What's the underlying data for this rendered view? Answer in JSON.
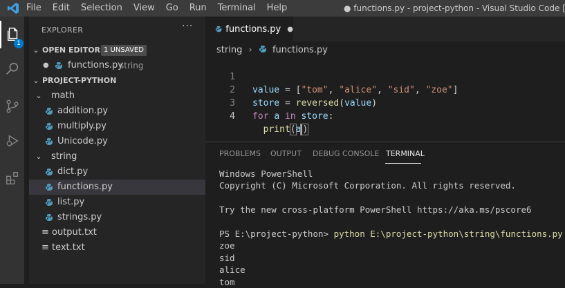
{
  "titlebar": {
    "menu": [
      "File",
      "Edit",
      "Selection",
      "View",
      "Go",
      "Run",
      "Terminal",
      "Help"
    ],
    "window_title": "● functions.py - project-python - Visual Studio Code [Unsup"
  },
  "activity": {
    "explorer_badge": "1"
  },
  "explorer": {
    "header": "EXPLORER",
    "more": "···",
    "open_editors": {
      "title": "OPEN EDITORS",
      "badge": "1 UNSAVED",
      "dot": "●",
      "file": "functions.py",
      "folder": "string"
    },
    "project": {
      "title": "PROJECT-PYTHON",
      "math": {
        "name": "math",
        "files": [
          "addition.py",
          "multiply.py",
          "Unicode.py"
        ]
      },
      "string": {
        "name": "string",
        "files": [
          "dict.py",
          "functions.py",
          "list.py",
          "strings.py"
        ]
      },
      "root_files": [
        "output.txt",
        "text.txt"
      ]
    }
  },
  "editor": {
    "tab": {
      "label": "functions.py",
      "dirty": "●"
    },
    "breadcrumb": {
      "folder": "string",
      "sep": "›",
      "file": "functions.py"
    },
    "line_numbers": [
      "1",
      "2",
      "3",
      "4"
    ],
    "code": {
      "l1": {
        "a": "value",
        "b": " = [",
        "c": "\"tom\"",
        "d": ", ",
        "e": "\"alice\"",
        "f": ", ",
        "g": "\"sid\"",
        "h": ", ",
        "i": "\"zoe\"",
        "j": "]"
      },
      "l2": {
        "a": "store",
        "b": " = ",
        "c": "reversed",
        "d": "(",
        "e": "value",
        "f": ")"
      },
      "l3": {
        "a": "for",
        "b": " ",
        "c": "a",
        "d": " ",
        "e": "in",
        "f": " ",
        "g": "store",
        "h": ":"
      },
      "l4": {
        "indent": "  ",
        "a": "print",
        "b": "(",
        "c": "a",
        "d": ")"
      }
    }
  },
  "panel": {
    "tabs": [
      "PROBLEMS",
      "OUTPUT",
      "DEBUG CONSOLE",
      "TERMINAL"
    ],
    "terminal": {
      "lines": [
        "Windows PowerShell",
        "Copyright (C) Microsoft Corporation. All rights reserved.",
        "",
        "Try the new cross-platform PowerShell https://aka.ms/pscore6",
        ""
      ],
      "prompt": "PS E:\\project-python> ",
      "command": "python E:\\project-python\\string\\functions.py",
      "output": [
        "zoe",
        "sid",
        "alice",
        "tom"
      ]
    }
  },
  "colors": {
    "accent": "#007acc",
    "python_icon": "#519aba",
    "string": "#ce9178",
    "keyword": "#c586c0",
    "function": "#dcdcaa",
    "variable": "#9cdcfe"
  }
}
